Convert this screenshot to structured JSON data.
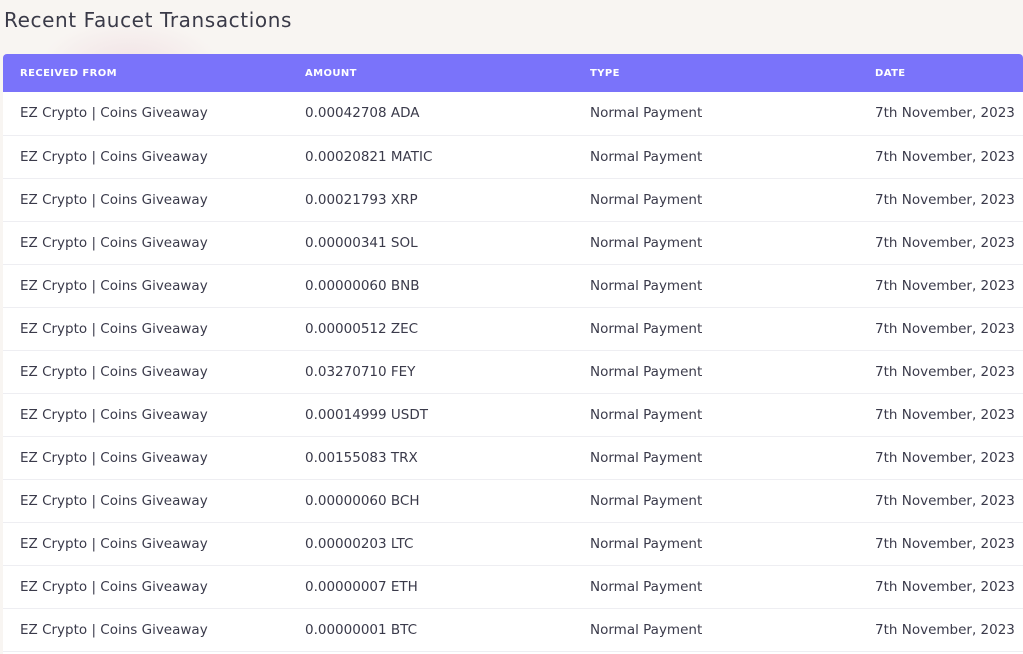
{
  "page": {
    "title": "Recent Faucet Transactions"
  },
  "table": {
    "headers": [
      "RECEIVED FROM",
      "AMOUNT",
      "TYPE",
      "DATE"
    ],
    "rows": [
      [
        "EZ Crypto | Coins Giveaway",
        "0.00042708 ADA",
        "Normal Payment",
        "7th November, 2023"
      ],
      [
        "EZ Crypto | Coins Giveaway",
        "0.00020821 MATIC",
        "Normal Payment",
        "7th November, 2023"
      ],
      [
        "EZ Crypto | Coins Giveaway",
        "0.00021793 XRP",
        "Normal Payment",
        "7th November, 2023"
      ],
      [
        "EZ Crypto | Coins Giveaway",
        "0.00000341 SOL",
        "Normal Payment",
        "7th November, 2023"
      ],
      [
        "EZ Crypto | Coins Giveaway",
        "0.00000060 BNB",
        "Normal Payment",
        "7th November, 2023"
      ],
      [
        "EZ Crypto | Coins Giveaway",
        "0.00000512 ZEC",
        "Normal Payment",
        "7th November, 2023"
      ],
      [
        "EZ Crypto | Coins Giveaway",
        "0.03270710 FEY",
        "Normal Payment",
        "7th November, 2023"
      ],
      [
        "EZ Crypto | Coins Giveaway",
        "0.00014999 USDT",
        "Normal Payment",
        "7th November, 2023"
      ],
      [
        "EZ Crypto | Coins Giveaway",
        "0.00155083 TRX",
        "Normal Payment",
        "7th November, 2023"
      ],
      [
        "EZ Crypto | Coins Giveaway",
        "0.00000060 BCH",
        "Normal Payment",
        "7th November, 2023"
      ],
      [
        "EZ Crypto | Coins Giveaway",
        "0.00000203 LTC",
        "Normal Payment",
        "7th November, 2023"
      ],
      [
        "EZ Crypto | Coins Giveaway",
        "0.00000007 ETH",
        "Normal Payment",
        "7th November, 2023"
      ],
      [
        "EZ Crypto | Coins Giveaway",
        "0.00000001 BTC",
        "Normal Payment",
        "7th November, 2023"
      ]
    ]
  },
  "colors": {
    "header_bg": "#7a73fa",
    "page_bg": "#f8f5f2",
    "row_divider": "#eeeef2"
  }
}
